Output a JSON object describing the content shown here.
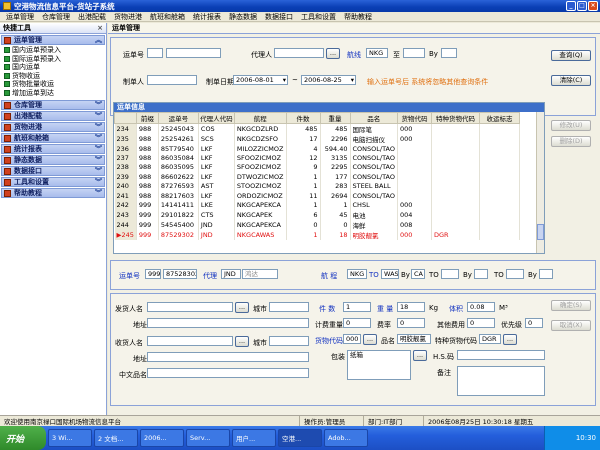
{
  "window": {
    "title": "空港物流信息平台-货站子系统"
  },
  "menu": [
    "运单管理",
    "仓库管理",
    "出港配载",
    "货物进港",
    "航班和舱箱",
    "统计报表",
    "静态数据",
    "数据接口",
    "工具和设置",
    "帮助教程"
  ],
  "left": {
    "title": "快捷工具",
    "group_open": "运单管理",
    "sub_items": [
      "国内运单预录入",
      "国际运单预录入",
      "国内运单",
      "货物收运",
      "货物批量收运",
      "增加运单到达"
    ],
    "groups": [
      "仓库管理",
      "出港配载",
      "货物进港",
      "航班和舱箱",
      "统计报表",
      "静态数据",
      "数据接口",
      "工具和设置",
      "帮助教程"
    ]
  },
  "main": {
    "title": "运单管理"
  },
  "query": {
    "waybill_label": "运单号",
    "agent_label": "代理人",
    "flight_label": "航线",
    "flight_from": "NKG",
    "to_label": "至",
    "by_label": "By",
    "maker_label": "制单人",
    "date_label": "制单日期",
    "date_from": "2006-08-01",
    "date_to": "2006-08-25",
    "hint": "输入运单号后  系统将忽略其他查询条件",
    "query_btn": "查询(Q)",
    "clear_btn": "清除(C)"
  },
  "grid": {
    "title": "运单信息",
    "columns": [
      "前缀",
      "运单号",
      "代理人代码",
      "航程",
      "件数",
      "重量",
      "品名",
      "货物代码",
      "特种货物代码",
      "收运标志"
    ],
    "rows": [
      {
        "n": "234",
        "c": [
          "988",
          "25245043",
          "COS",
          "NKGCDZLRD",
          "485",
          "485",
          "国际笔",
          "000",
          "",
          ""
        ]
      },
      {
        "n": "235",
        "c": [
          "988",
          "25254261",
          "SCS",
          "NKGCDZSFO",
          "17",
          "2296",
          "电脑扫描仪",
          "000",
          "",
          ""
        ]
      },
      {
        "n": "236",
        "c": [
          "988",
          "85T79540",
          "LKF",
          "MILOZZICMOZ",
          "4",
          "594.40",
          "CONSOL/TAO",
          "",
          "",
          ""
        ]
      },
      {
        "n": "237",
        "c": [
          "988",
          "86035084",
          "LKF",
          "SFOOZICMOZ",
          "12",
          "3135",
          "CONSOL/TAO",
          "",
          "",
          ""
        ]
      },
      {
        "n": "238",
        "c": [
          "988",
          "86035095",
          "LKF",
          "SFOOZICMOZ",
          "9",
          "2295",
          "CONSOL/TAO",
          "",
          "",
          ""
        ]
      },
      {
        "n": "239",
        "c": [
          "988",
          "86602622",
          "LKF",
          "DTWOZICMOZ",
          "1",
          "177",
          "CONSOL/TAO",
          "",
          "",
          ""
        ]
      },
      {
        "n": "240",
        "c": [
          "988",
          "87276593",
          "AST",
          "STOOZICMOZ",
          "1",
          "283",
          "STEEL BALL",
          "",
          "",
          ""
        ]
      },
      {
        "n": "241",
        "c": [
          "988",
          "88217603",
          "LKF",
          "ORDOZICMOZ",
          "11",
          "2694",
          "CONSOL/TAO",
          "",
          "",
          ""
        ]
      },
      {
        "n": "242",
        "c": [
          "999",
          "14141411",
          "LKE",
          "NKGCAPEKCA",
          "1",
          "1",
          "CHSL",
          "000",
          "",
          ""
        ]
      },
      {
        "n": "243",
        "c": [
          "999",
          "29101822",
          "CTS",
          "NKGCAPEK",
          "6",
          "45",
          "电池",
          "004",
          "",
          ""
        ]
      },
      {
        "n": "244",
        "c": [
          "999",
          "54545400",
          "JND",
          "NKGCAPEKCA",
          "0",
          "0",
          "海鲜",
          "008",
          "",
          ""
        ]
      },
      {
        "n": "▶245",
        "c": [
          "999",
          "87529302",
          "JND",
          "NKGCAWAS",
          "1",
          "18",
          "明胶靓氯",
          "000",
          "DGR",
          ""
        ],
        "red": true
      }
    ],
    "modify_btn": "修改(U)",
    "delete_btn": "删除(D)"
  },
  "detail": {
    "waybill_label": "运单号",
    "prefix": "999",
    "waybill_no": "87528302",
    "agent_label": "代理",
    "agent_code": "JND",
    "agent_name": "鸿达",
    "route_label": "航  程",
    "origin": "NKG",
    "to1": "TO",
    "dest": "WAS",
    "by1": "By",
    "carrier": "CA",
    "to2": "TO",
    "by2": "By",
    "to3": "TO",
    "by3": "By"
  },
  "bottom": {
    "shipper_label": "发货人名",
    "city_label": "城市",
    "address_label": "地址",
    "consignee_label": "收货人名",
    "city2_label": "城市",
    "address2_label": "地址",
    "cn_name_label": "中文品名",
    "pieces_label": "件  数",
    "pieces": "1",
    "weight_label": "重  量",
    "weight": "18",
    "kg": "Kg",
    "volume_label": "体积",
    "volume": "0.08",
    "m3": "M³",
    "charge_weight_label": "计费重量",
    "charge_weight": "0",
    "rate_label": "费率",
    "rate": "0",
    "other_fee_label": "其他费用",
    "other_fee": "0",
    "priority_label": "优先级",
    "priority": "0",
    "cargo_code_label": "货物代码",
    "cargo_code": "000",
    "goods_label": "品名",
    "goods": "明胶靓氯",
    "special_label": "特种货物代码",
    "special": "DGR",
    "packing_label": "包装",
    "packing": "纸箱",
    "hs_label": "H.S.码",
    "remark_label": "备注",
    "confirm_btn": "确定(S)",
    "cancel_btn": "取消(X)"
  },
  "status": {
    "welcome": "欢迎使用南京禄口国际机场物流信息平台",
    "operator": "操作员:管理员",
    "dept": "部门:IT部门",
    "datetime": "2006年08月25日  10:30:18  星期五"
  },
  "taskbar": {
    "start": "开始",
    "items": [
      "3 Wi...",
      "2 文档...",
      "2006...",
      "Serv...",
      "用户...",
      "空港...",
      "Adob..."
    ],
    "clock": "10:30"
  }
}
